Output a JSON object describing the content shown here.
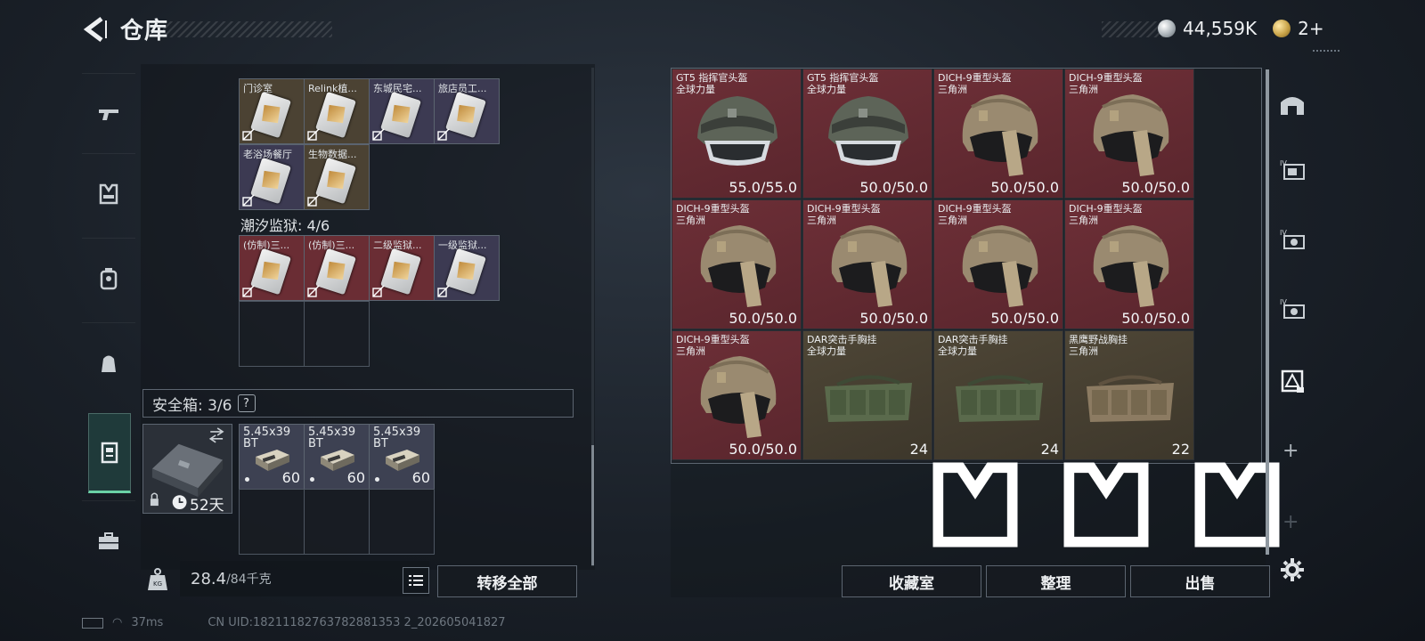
{
  "header": {
    "title": "仓库"
  },
  "currency": {
    "silver": "44,559K",
    "gold": "2+"
  },
  "left": {
    "row1": [
      {
        "label": "门诊室",
        "tint": "gold"
      },
      {
        "label": "Relink植...",
        "tint": "gold"
      },
      {
        "label": "东城民宅...",
        "tint": "purple"
      },
      {
        "label": "旅店员工...",
        "tint": "purple"
      }
    ],
    "row2": [
      {
        "label": "老浴场餐厅",
        "tint": "purple"
      },
      {
        "label": "生物数据...",
        "tint": "gold"
      }
    ],
    "prison_section": "潮汐监狱: 4/6",
    "row3": [
      {
        "label": "(仿制)三...",
        "tint": "red"
      },
      {
        "label": "(仿制)三...",
        "tint": "red"
      },
      {
        "label": "二级监狱...",
        "tint": "red"
      },
      {
        "label": "一级监狱...",
        "tint": "purple"
      }
    ],
    "safe_box_label": "安全箱: 3/6",
    "safe_box_help": "?",
    "safe_box_days": "52天",
    "ammo": [
      {
        "line1": "5.45x39",
        "line2": "BT",
        "qty": "60"
      },
      {
        "line1": "5.45x39",
        "line2": "BT",
        "qty": "60"
      },
      {
        "line1": "5.45x39",
        "line2": "BT",
        "qty": "60"
      }
    ],
    "weight_current": "28.4",
    "weight_max": "/84千克",
    "transfer_all": "转移全部"
  },
  "status": {
    "ping": "37ms",
    "uid": "CN UID:18211182763782881353 2_202605041827"
  },
  "right": {
    "items": [
      {
        "name1": "GT5 指挥官头盔",
        "name2": "全球力量",
        "value": "55.0/55.0",
        "tint": "red",
        "kind": "helmet-gt5"
      },
      {
        "name1": "GT5 指挥官头盔",
        "name2": "全球力量",
        "value": "50.0/50.0",
        "tint": "red",
        "kind": "helmet-gt5"
      },
      {
        "name1": "DICH-9重型头盔",
        "name2": "三角洲",
        "value": "50.0/50.0",
        "tint": "red",
        "kind": "helmet-dich"
      },
      {
        "name1": "DICH-9重型头盔",
        "name2": "三角洲",
        "value": "50.0/50.0",
        "tint": "red",
        "kind": "helmet-dich"
      },
      {
        "name1": "DICH-9重型头盔",
        "name2": "三角洲",
        "value": "50.0/50.0",
        "tint": "red",
        "kind": "helmet-dich"
      },
      {
        "name1": "DICH-9重型头盔",
        "name2": "三角洲",
        "value": "50.0/50.0",
        "tint": "red",
        "kind": "helmet-dich"
      },
      {
        "name1": "DICH-9重型头盔",
        "name2": "三角洲",
        "value": "50.0/50.0",
        "tint": "red",
        "kind": "helmet-dich"
      },
      {
        "name1": "DICH-9重型头盔",
        "name2": "三角洲",
        "value": "50.0/50.0",
        "tint": "red",
        "kind": "helmet-dich"
      },
      {
        "name1": "DICH-9重型头盔",
        "name2": "三角洲",
        "value": "50.0/50.0",
        "tint": "red",
        "kind": "helmet-dich"
      },
      {
        "name1": "DAR突击手胸挂",
        "name2": "全球力量",
        "value": "24",
        "tint": "gold",
        "kind": "rig-green"
      },
      {
        "name1": "DAR突击手胸挂",
        "name2": "全球力量",
        "value": "24",
        "tint": "gold",
        "kind": "rig-green"
      },
      {
        "name1": "黑鹰野战胸挂",
        "name2": "三角洲",
        "value": "22",
        "tint": "gold",
        "kind": "rig-tan"
      }
    ],
    "buttons": {
      "collection": "收藏室",
      "sort": "整理",
      "sell": "出售"
    }
  }
}
